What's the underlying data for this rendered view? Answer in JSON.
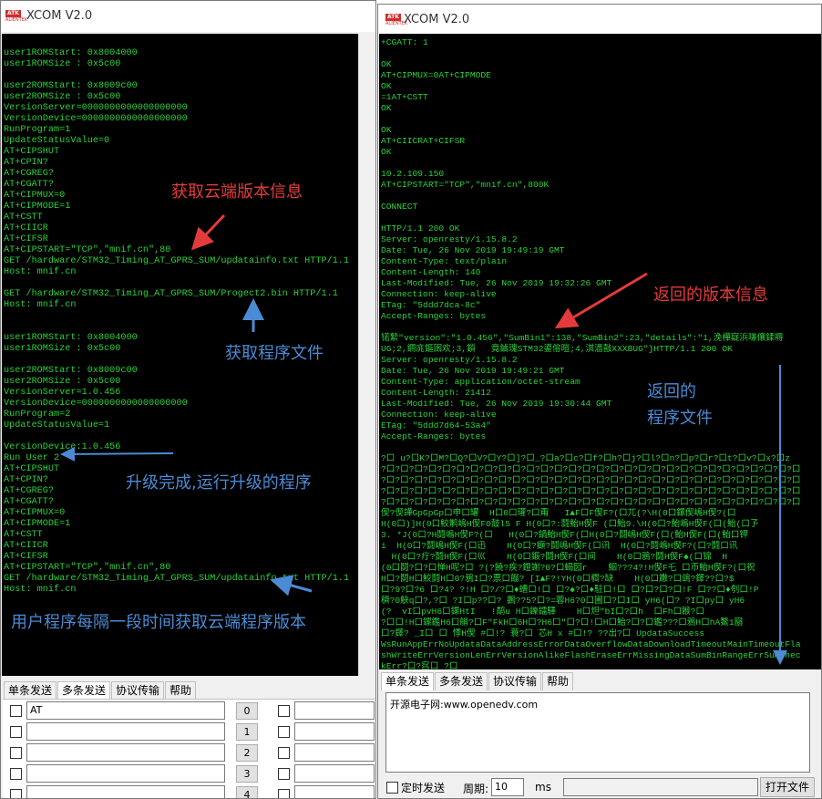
{
  "left_window": {
    "title": "XCOM V2.0",
    "logo_text": "ATK",
    "logo_sub": "ALIENTEK",
    "terminal_lines": [
      "",
      "user1ROMStart: 0x8004000",
      "user1ROMSize : 0x5c00",
      "",
      "user2ROMStart: 0x8009c00",
      "user2ROMSize : 0x5c00",
      "VersionServer=0000000000000000000",
      "VersionDevice=0000000000000000000",
      "RunProgram=1",
      "UpdateStatusValue=0",
      "AT+CIPSHUT",
      "AT+CPIN?",
      "AT+CGREG?",
      "AT+CGATT?",
      "AT+CIPMUX=0",
      "AT+CIPMODE=1",
      "AT+CSTT",
      "AT+CIICR",
      "AT+CIFSR",
      "AT+CIPSTART=\"TCP\",\"mnif.cn\",80",
      "GET /hardware/STM32_Timing_AT_GPRS_SUM/updatainfo.txt HTTP/1.1",
      "Host: mnif.cn",
      "",
      "GET /hardware/STM32_Timing_AT_GPRS_SUM/Progect2.bin HTTP/1.1",
      "Host: mnif.cn",
      "",
      "",
      "user1ROMStart: 0x8004000",
      "user1ROMSize : 0x5c00",
      "",
      "user2ROMStart: 0x8009c00",
      "user2ROMSize : 0x5c00",
      "VersionServer=1.0.456",
      "VersionDevice=0000000000000000000",
      "RunProgram=2",
      "UpdateStatusValue=1",
      "",
      "VersionDevice:1.0.456",
      "Run User 2",
      "AT+CIPSHUT",
      "AT+CPIN?",
      "AT+CGREG?",
      "AT+CGATT?",
      "AT+CIPMUX=0",
      "AT+CIPMODE=1",
      "AT+CSTT",
      "AT+CIICR",
      "AT+CIFSR",
      "AT+CIPSTART=\"TCP\",\"mnif.cn\",80",
      "GET /hardware/STM32_Timing_AT_GPRS_SUM/updatainfo.txt HTTP/1.1",
      "Host: mnif.cn"
    ],
    "annotations": {
      "get_cloud_version": "获取云端版本信息",
      "get_program_file": "获取程序文件",
      "upgrade_done": "升级完成,运行升级的程序",
      "periodic_check": "用户程序每隔一段时间获取云端程序版本"
    },
    "tabs": [
      "单条发送",
      "多条发送",
      "协议传输",
      "帮助"
    ],
    "multi_send_rows": [
      {
        "text": "AT",
        "button": "0"
      },
      {
        "text": "",
        "button": "1"
      },
      {
        "text": "",
        "button": "2"
      },
      {
        "text": "",
        "button": "3"
      },
      {
        "text": "",
        "button": "4"
      }
    ]
  },
  "right_window": {
    "title": "XCOM V2.0",
    "logo_text": "ATK",
    "logo_sub": "ALIENTEK",
    "terminal_lines": [
      "+CGATT: 1",
      "",
      "OK",
      "AT+CIPMUX=0AT+CIPMODE",
      "OK",
      "=1AT+CSTT",
      "OK",
      "",
      "OK",
      "AT+CIICRAT+CIFSR",
      "OK",
      "",
      "10.2.109.150",
      "AT+CIPSTART=\"TCP\",\"mnif.cn\",800K",
      "",
      "CONNECT",
      "",
      "HTTP/1.1 200 OK",
      "Server: openresty/1.15.8.2",
      "Date: Tue, 26 Nov 2019 19:49:19 GMT",
      "Content-Type: text/plain",
      "Content-Length: 140",
      "Last-Modified: Tue, 26 Nov 2019 19:32:26 GMT",
      "Connection: keep-alive",
      "ETag: \"5ddd7dca-8c\"",
      "Accept-Ranges: bytes",
      "",
      "锘縶\"version\":\"1.0.456\",\"SumBin1\":138,\"SumBin2\":23,\"details\":\"1,浼樺寲浜嗛儴鍒嗕",
      "UG;2,鐧庣鏂囦欢;3,鎻   竟鏀瑰STM32鍙傛暟;4,淇濇敼XXXBUG\"}HTTP/1.1 200 OK",
      "Server: openresty/1.15.8.2",
      "Date: Tue, 26 Nov 2019 19:49:21 GMT",
      "Content-Type: application/octet-stream",
      "Content-Length: 21412",
      "Last-Modified: Tue, 26 Nov 2019 19:30:44 GMT",
      "Connection: keep-alive",
      "ETag: \"5ddd7d64-53a4\"",
      "Accept-Ranges: bytes",
      "",
      "?口 u?口K?口M?口Q?口V?口Y?口]?口_?口a?口c?口f?口h?口j?口l?口n?口p?口r?口t?口v?口x?口z",
      "?口?口?口?口?口?口?口?口?口?口?口?口?口?口?口?口?口?口?口?口?口?口?口?口?口?口?口?口?口?口",
      "?口?口?口?口?口?口?口?口?口?口?口?口?口?口?口?口?口?口?口?口?口?口?口?口?口?口?口?口?口?口",
      "?口?口?口?口?口?口?口?口?口?口?口?口?口?口?口?口?口?口?口?口?口?口?口?口?口?口?口?口?口?口",
      "?口?口?口?口?口?口?口?口?口?口?口?口?口?口?口?口?口?口?口?口?口?口?口?口?口?口?口?口?口?口",
      "偰?偰譁GpGpGp口申口罐  H口0口瓘?口甭   I▲F口F偰F?(口兀(?\\H(0口鏍偰嶋H偰?(口",
      "H(0口)]H(0口鮫鹣嶋H偰F0鼓l5 F H(0口?:鬪鮐H偰F (口鮐9.\\H(0口?鮐嶋H偰F(口(鮐(口孒",
      "3. *J(0口?H鬪嶋H偰F?(口   H(0口?鍋鮐H偰F(口H(0口?鬪嶋H偰F(口(鮐H偰F(口(鮐口钾",
      "i  H(0口?鬪嶋H偰F(口迅    H(0口?癲?鬪嶋H偰F(口讯  H(0口?鬪嶋H偰F?(口?鬪口讯",
      "  H(0口?疔?鬪H偰F(口巛    H(0口鍛?鬪H偰F(口间    H(0口鴉?鬪H偰F♠(口锦  H",
      "(0口鬪?口?口惮H呢?口 ?(?饒?疾?鐙謝?0?口蝎圀r    鮂???4?!H偰F乇 口币鮐H偰F?(口祝",
      "H口?鬪H口鮫鬪H口0?鴉I口?票口餾? [I▲F?!YH(0口櫚?缺    H(0口饊?口鴿?鐸??口?$",
      "口?9?口?6 口?4? ?!H 口?/?口♦螬口!口 口?♠?口♦駐口!口 口?口?口?口!F 口??口♦刳口!P",
      "穧?0觖q口?,?口 ?I口p??口? 鵝??5?口?=蓉H6?0口圃口?口I口 yH6(口? ?I口py口 yH6",
      "(?  vI口pvH6口鏍HtI   !鹬u H口鑠鐳驛    H口炟\"bI口?口h  口Fh口餱?口",
      "?口口!H口鏍鑑H6口艄?口F\"FkH口6H口?H6口\"口?口!口H口鮐?口?口鑑???口鴉H口hA鰲1圝",
      "口?鐸? _I口 口 悸H偰 #口!? 蓑?口 芯H x #口!? ??出?口 UpdataSuccess",
      "WsRunAppErrNoUpdataDataAddressErrorDataOverflowDataDownloadTimeoutMainTimeoutFla",
      "shWriteErrVersionLenErrVersionAlikeFlashEraseErrMissingDataSumBinRangeErrSumChec",
      "kErr?口?窞口 ?口"
    ],
    "annotations": {
      "returned_version": "返回的版本信息",
      "returned_program_1": "返回的",
      "returned_program_2": "程序文件"
    },
    "tabs": [
      "单条发送",
      "多条发送",
      "协议传输",
      "帮助"
    ],
    "send_text": "开源电子网:www.openedv.com",
    "timed_send_label": "定时发送",
    "period_label": "周期:",
    "period_value": "10",
    "period_unit": "ms",
    "open_file_button": "打开文件"
  },
  "colors": {
    "terminal_bg": "#000000",
    "terminal_text": "#2bd23a",
    "annotation_red": "#e33b3b",
    "annotation_blue": "#4a8bd4"
  }
}
